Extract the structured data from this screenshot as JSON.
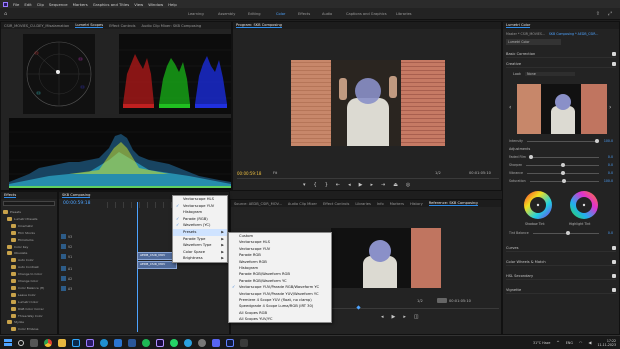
{
  "menubar": [
    "File",
    "Edit",
    "Clip",
    "Sequence",
    "Markers",
    "Graphics and Titles",
    "View",
    "Window",
    "Help"
  ],
  "workspaces": [
    {
      "label": "Learning",
      "active": false
    },
    {
      "label": "Assembly",
      "active": false
    },
    {
      "label": "Editing",
      "active": false
    },
    {
      "label": "Color",
      "active": true
    },
    {
      "label": "Effects",
      "active": false
    },
    {
      "label": "Audio",
      "active": false
    },
    {
      "label": "Captions and Graphics",
      "active": false
    },
    {
      "label": "Libraries",
      "active": false
    }
  ],
  "scopes_panel": {
    "tabs": [
      {
        "label": "CSIR_MOVIES_CU-DEY_Misalamation",
        "active": false
      },
      {
        "label": "Lumetri Scopes",
        "active": true
      },
      {
        "label": "Effect Controls",
        "active": false
      },
      {
        "label": "Audio Clip Mixer: SKB Composing",
        "active": false
      }
    ]
  },
  "program_monitor": {
    "tab": "Program: SKB Composing",
    "timecode": "00:00:59:18",
    "zoom": "Fit",
    "quality": "1/2",
    "duration": "00:01:05:10"
  },
  "lumetri_color": {
    "tabs": [
      "Lumetri Color"
    ],
    "master": "Master * CSIR_MOVIES...",
    "clip": "SKB Composing * AEDB_CSIR...",
    "effect_name": "Lumetri Color",
    "sections": [
      {
        "label": "Basic Correction",
        "checked": true
      },
      {
        "label": "Creative",
        "checked": true
      }
    ],
    "look_label": "Look",
    "look_value": "None",
    "intensity_label": "Intensity",
    "intensity_value": "100.0",
    "adjustments_label": "Adjustments",
    "sliders": [
      {
        "label": "Faded Film",
        "value": "0.0",
        "pos": 0.02
      },
      {
        "label": "Sharpen",
        "value": "0.0",
        "pos": 0.5
      },
      {
        "label": "Vibrance",
        "value": "0.0",
        "pos": 0.5
      },
      {
        "label": "Saturation",
        "value": "100.0",
        "pos": 0.5
      }
    ],
    "wheel_labels": [
      "Shadow Tint",
      "Highlight Tint"
    ],
    "tint_balance_label": "Tint Balance",
    "tint_balance_value": "0.0",
    "bottom_sections": [
      {
        "label": "Curves",
        "checked": true
      },
      {
        "label": "Color Wheels & Match",
        "checked": true
      },
      {
        "label": "HSL Secondary",
        "checked": true
      },
      {
        "label": "Vignette",
        "checked": true
      }
    ]
  },
  "project_panel": {
    "tabs": [
      "Effects",
      "Project: SKB Composing"
    ],
    "search_placeholder": "",
    "items": [
      {
        "label": "Presets",
        "indent": 0
      },
      {
        "label": "Lumetri Presets",
        "indent": 1
      },
      {
        "label": "Cinematic",
        "indent": 2
      },
      {
        "label": "Film Stocks",
        "indent": 2
      },
      {
        "label": "Filmstocks",
        "indent": 2
      },
      {
        "label": "Color Key",
        "indent": 1
      },
      {
        "label": "Obsolete",
        "indent": 1
      },
      {
        "label": "Auto Color",
        "indent": 2
      },
      {
        "label": "Auto Contrast",
        "indent": 2
      },
      {
        "label": "Change to Color",
        "indent": 2
      },
      {
        "label": "Change Color",
        "indent": 2
      },
      {
        "label": "Color Balance (H)",
        "indent": 2
      },
      {
        "label": "Leave Color",
        "indent": 2
      },
      {
        "label": "Lumetri Color",
        "indent": 2
      },
      {
        "label": "RGB Color Correc",
        "indent": 2
      },
      {
        "label": "Three-Way Color",
        "indent": 2
      },
      {
        "label": "Stylize",
        "indent": 1
      },
      {
        "label": "Color Emboss",
        "indent": 2
      }
    ]
  },
  "timeline": {
    "tab": "SKB Composing",
    "timecode": "00:00:59:18",
    "clips": [
      "AEDB_CSIR_MOV",
      "AEDB_CSIR_MOV"
    ]
  },
  "context_menu_1": {
    "items": [
      {
        "label": "Vectorscope HLS",
        "checked": false,
        "arrow": false
      },
      {
        "label": "Vectorscope YUV",
        "checked": true,
        "arrow": false
      },
      {
        "label": "Histogram",
        "checked": false,
        "arrow": false
      },
      {
        "label": "Parade (RGB)",
        "checked": true,
        "arrow": false
      },
      {
        "label": "Waveform (YC)",
        "checked": true,
        "arrow": false
      },
      {
        "label": "Presets",
        "checked": false,
        "arrow": true,
        "highlight": true
      },
      {
        "label": "Parade Type",
        "checked": false,
        "arrow": true
      },
      {
        "label": "Waveform Type",
        "checked": false,
        "arrow": true
      },
      {
        "label": "Color Space",
        "checked": false,
        "arrow": true
      },
      {
        "label": "Brightness",
        "checked": false,
        "arrow": true
      }
    ]
  },
  "context_menu_2": {
    "items": [
      {
        "label": "Custom",
        "checked": false
      },
      {
        "label": "Vectorscope HLS",
        "checked": false
      },
      {
        "label": "Vectorscope YUV",
        "checked": false
      },
      {
        "label": "Parade RGB",
        "checked": false
      },
      {
        "label": "Waveform RGB",
        "checked": false
      },
      {
        "label": "Histogram",
        "checked": false
      },
      {
        "label": "Parade RGB/Waveform RGB",
        "checked": false
      },
      {
        "label": "Parade RGB/Waveform YC",
        "checked": false
      },
      {
        "label": "Vectorscope YUV/Parade RGB/Waveform YC",
        "checked": true
      },
      {
        "label": "Vectorscope YUV/Parade YUV/Waveform YC",
        "checked": false
      },
      {
        "label": "Premiere 4 Scope YUV (float, no clamp)",
        "checked": false
      },
      {
        "label": "Speedgrade 4 Scope Luma/RGB (IRT 30)",
        "checked": false
      },
      {
        "label": "All Scopes RGB",
        "checked": false
      },
      {
        "label": "All Scopes YUV/YC",
        "checked": false
      }
    ]
  },
  "source_tabs": [
    "Source: AEDB_CSIR_MOV...",
    "Audio Clip Mixer",
    "Effect Controls",
    "Libraries",
    "Info",
    "Markers",
    "History",
    "Reference: SKB Composing"
  ],
  "reference_monitor": {
    "quality": "1/2",
    "timecode": "00:00:59:18",
    "duration": "00:01:05:10"
  },
  "taskbar": {
    "weather": "31°C Haze",
    "lang": "ENG",
    "time": "17:22",
    "date": "11-11-2023"
  },
  "colors": {
    "accent": "#2d8ceb",
    "wall_left": "#c98a6a",
    "wall_right": "#c07560"
  }
}
